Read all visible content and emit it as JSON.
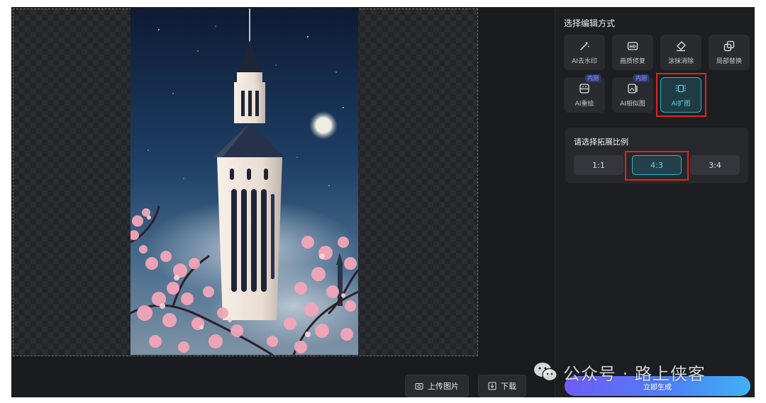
{
  "panel": {
    "title": "选择编辑方式",
    "tools": [
      {
        "label": "AI去水印",
        "icon": "magic-wand-icon",
        "beta": ""
      },
      {
        "label": "画质修复",
        "icon": "hd-icon",
        "beta": ""
      },
      {
        "label": "涂抹消除",
        "icon": "eraser-icon",
        "beta": ""
      },
      {
        "label": "局部替换",
        "icon": "replace-icon",
        "beta": ""
      },
      {
        "label": "AI重绘",
        "icon": "redraw-icon",
        "beta": "内测"
      },
      {
        "label": "AI相似图",
        "icon": "similar-image-icon",
        "beta": "内测"
      },
      {
        "label": "AI扩图",
        "icon": "expand-icon",
        "beta": "",
        "selected": true
      }
    ],
    "ratio": {
      "title": "请选择拓展比例",
      "options": [
        "1:1",
        "4:3",
        "3:4"
      ],
      "selected": "4:3"
    },
    "generate_label": "立即生成"
  },
  "canvas": {
    "upload_label": "上传图片",
    "download_label": "下载"
  },
  "watermark": {
    "text": "公众号 · 路上侠客"
  },
  "colors": {
    "accent": "#2bb4c6",
    "highlight": "#e02424",
    "background": "#1a1b1e"
  }
}
